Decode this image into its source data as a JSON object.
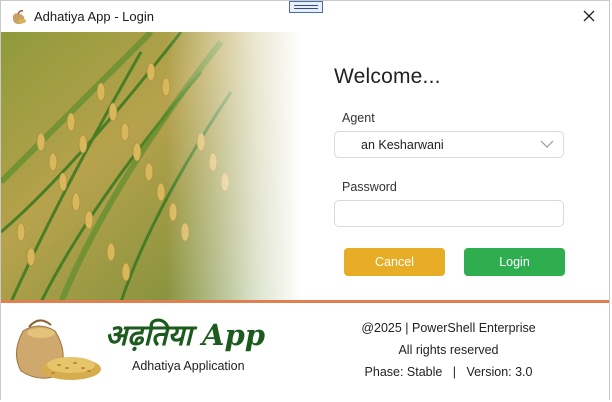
{
  "window": {
    "title": "Adhatiya App - Login",
    "app_icon": "grain-sack-icon",
    "close_icon": "close-icon"
  },
  "login": {
    "welcome": "Welcome...",
    "agent_label": "Agent",
    "agent_value": "an Kesharwani",
    "password_label": "Password",
    "password_value": "",
    "cancel_label": "Cancel",
    "login_label": "Login"
  },
  "footer": {
    "brand_title": "अढ़तिया App",
    "brand_subtitle": "Adhatiya Application",
    "copyright": "@2025 | PowerShell Enterprise",
    "rights": "All rights reserved",
    "phase_version": "Phase: Stable   |   Version: 3.0"
  },
  "colors": {
    "accent_line": "#e07f52",
    "cancel": "#e8ad27",
    "login": "#2eae4f",
    "brand": "#1d5a1e"
  }
}
